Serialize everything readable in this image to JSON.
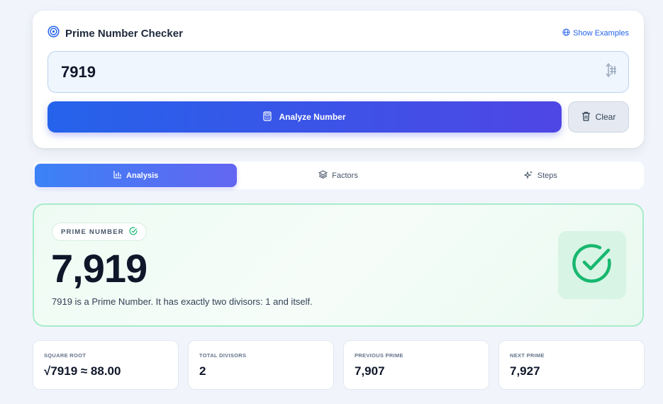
{
  "header": {
    "title": "Prime Number Checker",
    "examples_label": "Show Examples"
  },
  "input": {
    "value": "7919",
    "placeholder": ""
  },
  "actions": {
    "analyze_label": "Analyze Number",
    "clear_label": "Clear"
  },
  "tabs": [
    {
      "label": "Analysis",
      "icon": "bar-chart-icon",
      "active": true
    },
    {
      "label": "Factors",
      "icon": "layers-icon",
      "active": false
    },
    {
      "label": "Steps",
      "icon": "sparkles-icon",
      "active": false
    }
  ],
  "result": {
    "badge": "PRIME NUMBER",
    "number": "7,919",
    "description": "7919 is a Prime Number. It has exactly two divisors: 1 and itself."
  },
  "stats": [
    {
      "label": "SQUARE ROOT",
      "value": "√7919 ≈ 88.00"
    },
    {
      "label": "TOTAL DIVISORS",
      "value": "2"
    },
    {
      "label": "PREVIOUS PRIME",
      "value": "7,907"
    },
    {
      "label": "NEXT PRIME",
      "value": "7,927"
    }
  ],
  "colors": {
    "accent": "#2563eb",
    "accent_end": "#4f46e5",
    "success": "#16b86e"
  }
}
